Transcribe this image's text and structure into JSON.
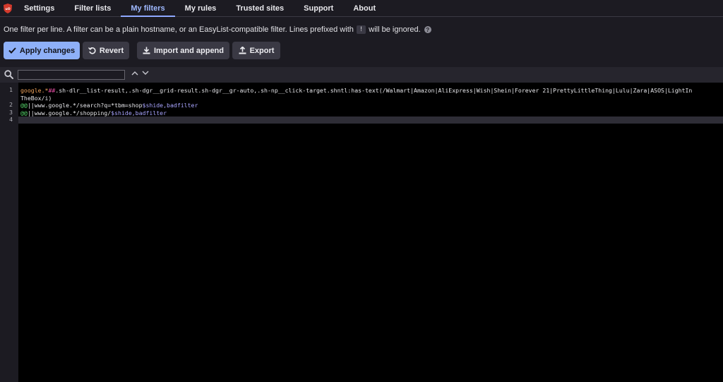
{
  "nav": {
    "tabs": [
      {
        "label": "Settings"
      },
      {
        "label": "Filter lists"
      },
      {
        "label": "My filters"
      },
      {
        "label": "My rules"
      },
      {
        "label": "Trusted sites"
      },
      {
        "label": "Support"
      },
      {
        "label": "About"
      }
    ],
    "active_tab": "My filters",
    "logo_text": "uO"
  },
  "info": {
    "text_before": "One filter per line. A filter can be a plain hostname, or an EasyList-compatible filter. Lines prefixed with",
    "kbd": "!",
    "text_after": "will be ignored."
  },
  "buttons": {
    "apply": "Apply changes",
    "revert": "Revert",
    "import": "Import and append",
    "export": "Export"
  },
  "search": {
    "value": "",
    "placeholder": ""
  },
  "editor": {
    "line_numbers": [
      "1",
      "2",
      "3",
      "4"
    ],
    "line1": {
      "host": "google.*",
      "separator": "##",
      "selector_a": ".sh-dlr__list-result,.sh-dgr__grid-result.sh-dgr__gr-auto,.sh-np__click-target.shntl:has-text(/Walmart|Amazon|AliExpress|Wish|Shein|Forever 21|PrettyLittleThing|Lulu|Zara|ASOS|LightIn",
      "selector_b": "TheBox/i)"
    },
    "line2": {
      "prefix": "@@",
      "pattern": "||www.google.*/search?q=*tbm=shop",
      "options": "$shide,badfilter"
    },
    "line3": {
      "prefix": "@@",
      "pattern": "||www.google.*/shopping/",
      "options": "$shide,badfilter"
    }
  },
  "colors": {
    "accent": "#8eb0f8",
    "active_tab": "#9fb9ff",
    "logo": "#d33a2c",
    "hostname": "#f0a35b",
    "separator": "#e64ea4",
    "exception": "#55d46a",
    "options": "#a9a5ff"
  }
}
